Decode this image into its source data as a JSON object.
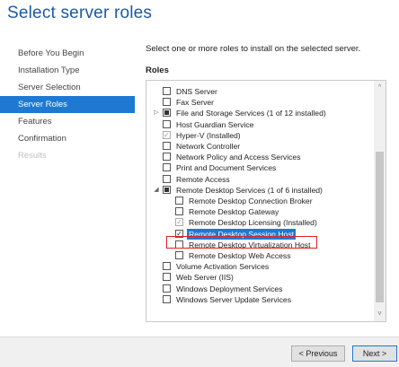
{
  "title": "Select server roles",
  "nav": [
    "Before You Begin",
    "Installation Type",
    "Server Selection",
    "Server Roles",
    "Features",
    "Confirmation",
    "Results"
  ],
  "instruction": "Select one or more roles to install on the selected server.",
  "roles_heading": "Roles",
  "roles": [
    {
      "label": "DNS Server",
      "state": "unchecked"
    },
    {
      "label": "Fax Server",
      "state": "unchecked"
    },
    {
      "label": "File and Storage Services (1 of 12 installed)",
      "state": "partial",
      "expander": "▷"
    },
    {
      "label": "Host Guardian Service",
      "state": "unchecked"
    },
    {
      "label": "Hyper-V (Installed)",
      "state": "installed"
    },
    {
      "label": "Network Controller",
      "state": "unchecked"
    },
    {
      "label": "Network Policy and Access Services",
      "state": "unchecked"
    },
    {
      "label": "Print and Document Services",
      "state": "unchecked"
    },
    {
      "label": "Remote Access",
      "state": "unchecked"
    },
    {
      "label": "Remote Desktop Services (1 of 6 installed)",
      "state": "partial",
      "expander": "◢"
    },
    {
      "label": "Remote Desktop Connection Broker",
      "state": "unchecked",
      "child": true
    },
    {
      "label": "Remote Desktop Gateway",
      "state": "unchecked",
      "child": true
    },
    {
      "label": "Remote Desktop Licensing (Installed)",
      "state": "installed",
      "child": true
    },
    {
      "label": "Remote Desktop Session Host",
      "state": "checked",
      "child": true,
      "selected": true
    },
    {
      "label": "Remote Desktop Virtualization Host",
      "state": "unchecked",
      "child": true
    },
    {
      "label": "Remote Desktop Web Access",
      "state": "unchecked",
      "child": true
    },
    {
      "label": "Volume Activation Services",
      "state": "unchecked"
    },
    {
      "label": "Web Server (IIS)",
      "state": "unchecked"
    },
    {
      "label": "Windows Deployment Services",
      "state": "unchecked"
    },
    {
      "label": "Windows Server Update Services",
      "state": "unchecked"
    }
  ],
  "buttons": {
    "previous": "< Previous",
    "next": "Next >"
  },
  "colors": {
    "title": "#1a5aa5",
    "accent": "#1e79d3",
    "highlight_box": "#e02020"
  }
}
